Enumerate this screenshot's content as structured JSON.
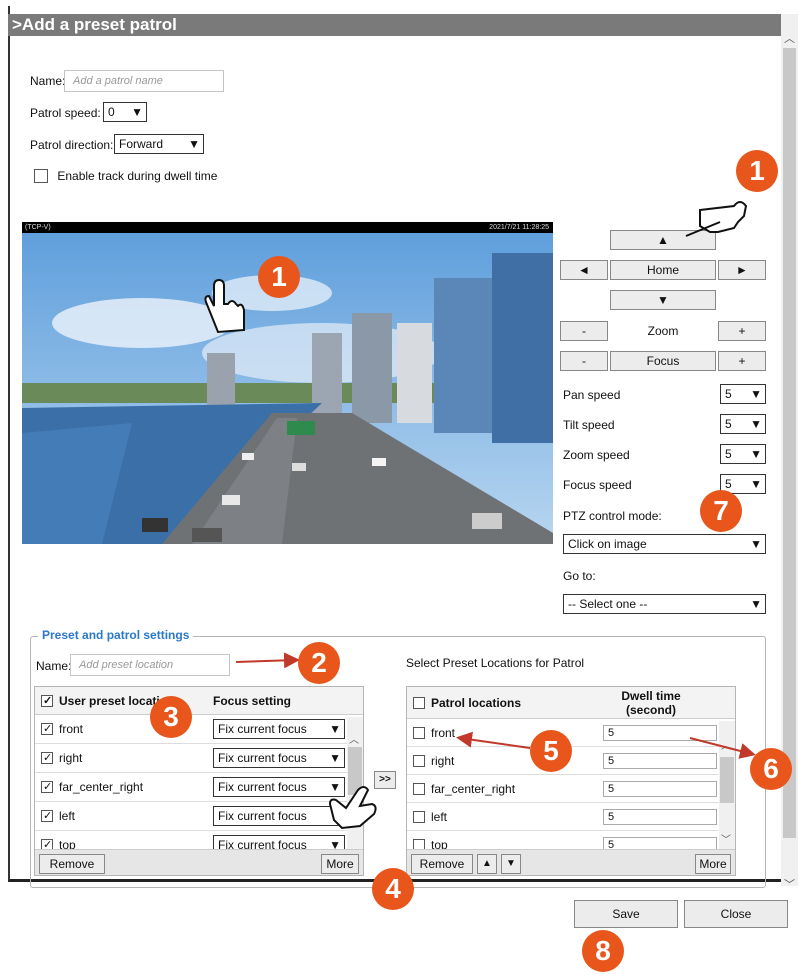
{
  "title": ">Add a preset patrol",
  "form": {
    "name_label": "Name:",
    "name_placeholder": "Add a patrol name",
    "patrol_speed_label": "Patrol speed:",
    "patrol_speed_value": "0",
    "patrol_direction_label": "Patrol direction:",
    "patrol_direction_value": "Forward",
    "enable_track_label": "Enable track during dwell time"
  },
  "camera": {
    "source_label": "(TCP-V)",
    "timestamp": "2021/7/21 11:28:25"
  },
  "ptz": {
    "up": "▲",
    "left": "◄",
    "home": "Home",
    "right": "►",
    "down": "▼",
    "minus": "-",
    "plus": "+",
    "zoom": "Zoom",
    "focus": "Focus",
    "pan_speed_label": "Pan speed",
    "pan_speed_value": "5",
    "tilt_speed_label": "Tilt speed",
    "tilt_speed_value": "5",
    "zoom_speed_label": "Zoom speed",
    "zoom_speed_value": "5",
    "focus_speed_label": "Focus speed",
    "focus_speed_value": "5",
    "control_mode_label": "PTZ control mode:",
    "control_mode_value": "Click on image",
    "goto_label": "Go to:",
    "goto_value": "-- Select one --"
  },
  "preset_settings": {
    "legend": "Preset and patrol settings",
    "name_label": "Name:",
    "name_placeholder": "Add preset location",
    "user_header": "User preset locati",
    "focus_header": "Focus setting",
    "rows": [
      {
        "name": "front",
        "focus": "Fix current focus"
      },
      {
        "name": "right",
        "focus": "Fix current focus"
      },
      {
        "name": "far_center_right",
        "focus": "Fix current focus"
      },
      {
        "name": "left",
        "focus": "Fix current focus"
      },
      {
        "name": "top",
        "focus": "Fix current focus"
      }
    ],
    "remove": "Remove",
    "more": "More",
    "transfer": ">>"
  },
  "patrol": {
    "heading": "Select Preset Locations for Patrol",
    "locations_header": "Patrol locations",
    "dwell_header_1": "Dwell time",
    "dwell_header_2": "(second)",
    "rows": [
      {
        "name": "front",
        "dwell": "5"
      },
      {
        "name": "right",
        "dwell": "5"
      },
      {
        "name": "far_center_right",
        "dwell": "5"
      },
      {
        "name": "left",
        "dwell": "5"
      },
      {
        "name": "top",
        "dwell": "5"
      }
    ],
    "remove": "Remove",
    "move_up": "▲",
    "move_down": "▼",
    "more": "More"
  },
  "footer": {
    "save": "Save",
    "close": "Close"
  },
  "badges": {
    "b1": "1",
    "b2": "2",
    "b3": "3",
    "b4": "4",
    "b5": "5",
    "b6": "6",
    "b7": "7",
    "b8": "8"
  },
  "colors": {
    "title_bar": "#7a7a7a",
    "badge": "#e8561c",
    "legend": "#2a78c8",
    "arrow": "#c0392b"
  }
}
